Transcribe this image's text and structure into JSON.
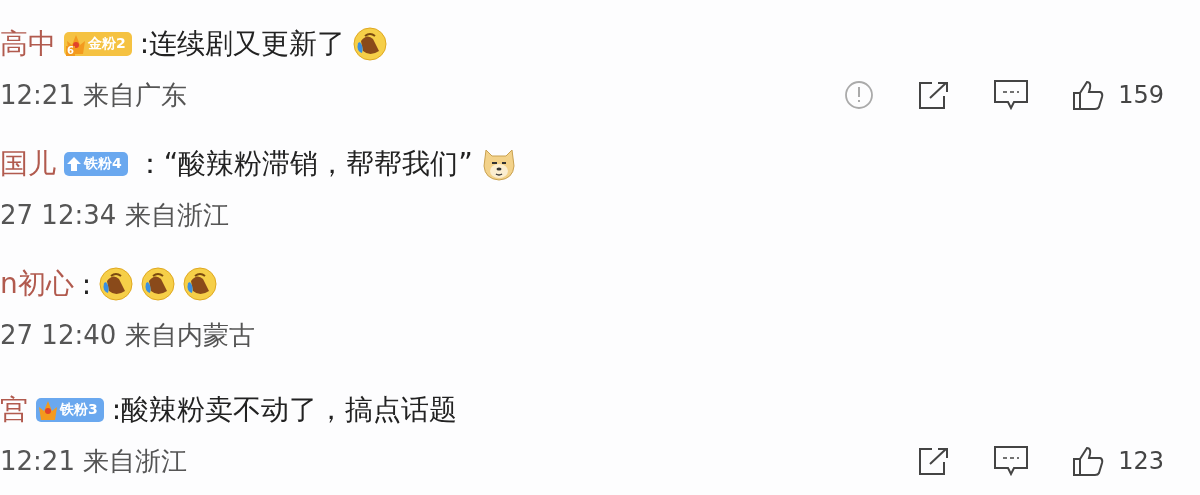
{
  "comments": [
    {
      "name": "高中",
      "badge": {
        "kind": "gold-crown",
        "text": "金粉2",
        "crown_text": "6"
      },
      "content": [
        {
          "kind": "text",
          "text": ":连续剧又更新了"
        },
        {
          "kind": "laugh"
        }
      ],
      "time": "12:21",
      "location": "来自广东",
      "actions": [
        {
          "kind": "report"
        },
        {
          "kind": "share"
        },
        {
          "kind": "comment"
        },
        {
          "kind": "like",
          "count": "159"
        }
      ]
    },
    {
      "name": "国儿",
      "badge": {
        "kind": "blue-arrow",
        "text": "铁粉4"
      },
      "content": [
        {
          "kind": "text",
          "text": "：“酸辣粉滞销，帮帮我们”"
        },
        {
          "kind": "dog"
        }
      ],
      "time": "27 12:34",
      "location": "来自浙江"
    },
    {
      "name": "n初心",
      "content": [
        {
          "kind": "text",
          "text": ":"
        },
        {
          "kind": "laugh"
        },
        {
          "kind": "laugh"
        },
        {
          "kind": "laugh"
        }
      ],
      "time": "27 12:40",
      "location": "来自内蒙古"
    },
    {
      "name": "宫",
      "badge": {
        "kind": "blue-crown",
        "text": "铁粉3"
      },
      "content": [
        {
          "kind": "text",
          "text": ":酸辣粉卖不动了，搞点话题"
        }
      ],
      "time": "12:21",
      "location": "来自浙江",
      "actions": [
        {
          "kind": "share"
        },
        {
          "kind": "comment"
        },
        {
          "kind": "like",
          "count": "123"
        }
      ]
    }
  ]
}
